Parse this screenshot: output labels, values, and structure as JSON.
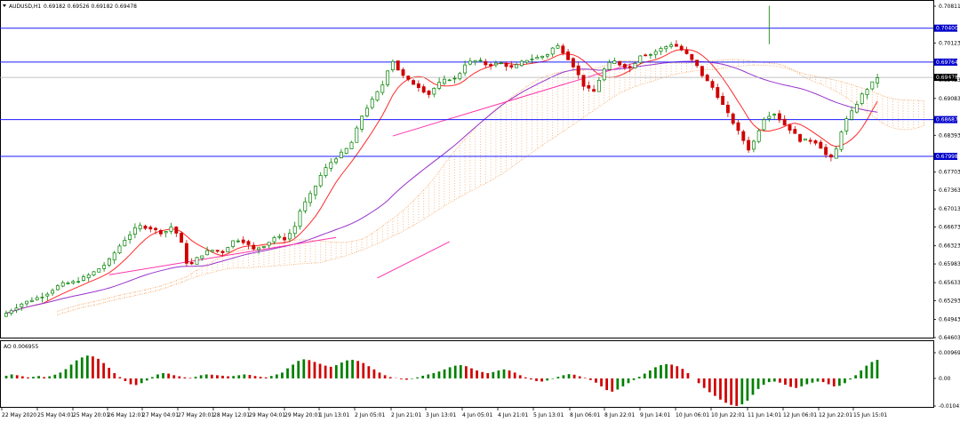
{
  "chart_data": {
    "type": "candlestick",
    "symbol_header": "AUDUSD,H1",
    "ohlc_header": "0.69182 0.69526 0.69182 0.69478",
    "price_axis_ticks": [
      "0.70811",
      "0.70123",
      "0.69433",
      "0.69083",
      "0.68393",
      "0.67703",
      "0.67363",
      "0.67013",
      "0.66673",
      "0.66323",
      "0.65983",
      "0.65633",
      "0.65293",
      "0.64943",
      "0.64603"
    ],
    "ylim": [
      0.64603,
      0.70811
    ],
    "horizontal_levels": [
      {
        "label": "0.70400",
        "value": 0.704
      },
      {
        "label": "0.69764",
        "value": 0.69764
      },
      {
        "label": "0.68687",
        "value": 0.68687
      },
      {
        "label": "0.67998",
        "value": 0.67998
      }
    ],
    "current_price": {
      "label": "0.69478",
      "value": 0.69478
    },
    "time_labels": [
      "22 May 2020",
      "25 May 04:01",
      "25 May 20:01",
      "26 May 12:01",
      "27 May 04:01",
      "27 May 20:01",
      "28 May 12:01",
      "29 May 04:01",
      "29 May 20:01",
      "1 Jun 13:01",
      "2 Jun 05:01",
      "2 Jun 21:01",
      "3 Jun 13:01",
      "4 Jun 05:01",
      "4 Jun 21:01",
      "5 Jun 13:01",
      "8 Jun 06:01",
      "8 Jun 22:01",
      "9 Jun 14:01",
      "10 Jun 06:01",
      "10 Jun 22:01",
      "11 Jun 14:01",
      "12 Jun 06:01",
      "12 Jun 22:01",
      "15 Jun 15:01"
    ],
    "ao_indicator": {
      "header": "AO 0.006955",
      "ticks": [
        "0.009697",
        "0.00",
        "-0.010417"
      ],
      "ylim": [
        -0.010417,
        0.009697
      ]
    },
    "close_path": [
      [
        0,
        0.65
      ],
      [
        14,
        0.6525
      ],
      [
        28,
        0.654
      ],
      [
        38,
        0.656
      ],
      [
        48,
        0.6565
      ],
      [
        58,
        0.658
      ],
      [
        68,
        0.66
      ],
      [
        78,
        0.664
      ],
      [
        88,
        0.667
      ],
      [
        96,
        0.6665
      ],
      [
        104,
        0.6655
      ],
      [
        110,
        0.667
      ],
      [
        116,
        0.6635
      ],
      [
        120,
        0.659
      ],
      [
        126,
        0.661
      ],
      [
        134,
        0.6625
      ],
      [
        142,
        0.662
      ],
      [
        150,
        0.6645
      ],
      [
        156,
        0.664
      ],
      [
        162,
        0.6625
      ],
      [
        170,
        0.6635
      ],
      [
        176,
        0.665
      ],
      [
        182,
        0.6645
      ],
      [
        188,
        0.6665
      ],
      [
        192,
        0.67
      ],
      [
        200,
        0.6735
      ],
      [
        206,
        0.677
      ],
      [
        212,
        0.679
      ],
      [
        218,
        0.6805
      ],
      [
        224,
        0.682
      ],
      [
        232,
        0.688
      ],
      [
        238,
        0.6905
      ],
      [
        246,
        0.694
      ],
      [
        250,
        0.6985
      ],
      [
        256,
        0.6955
      ],
      [
        262,
        0.694
      ],
      [
        268,
        0.693
      ],
      [
        274,
        0.6915
      ],
      [
        280,
        0.6935
      ],
      [
        286,
        0.6945
      ],
      [
        292,
        0.6945
      ],
      [
        298,
        0.6975
      ],
      [
        306,
        0.698
      ],
      [
        312,
        0.697
      ],
      [
        320,
        0.6975
      ],
      [
        328,
        0.6965
      ],
      [
        336,
        0.698
      ],
      [
        344,
        0.6985
      ],
      [
        350,
        0.699
      ],
      [
        356,
        0.701
      ],
      [
        362,
        0.699
      ],
      [
        368,
        0.6965
      ],
      [
        374,
        0.693
      ],
      [
        380,
        0.692
      ],
      [
        386,
        0.696
      ],
      [
        392,
        0.698
      ],
      [
        398,
        0.697
      ],
      [
        404,
        0.6965
      ],
      [
        410,
        0.699
      ],
      [
        416,
        0.699
      ],
      [
        422,
        0.7
      ],
      [
        430,
        0.701
      ],
      [
        434,
        0.7005
      ],
      [
        440,
        0.699
      ],
      [
        446,
        0.697
      ],
      [
        450,
        0.695
      ],
      [
        456,
        0.693
      ],
      [
        462,
        0.69
      ],
      [
        468,
        0.687
      ],
      [
        474,
        0.684
      ],
      [
        480,
        0.681
      ],
      [
        486,
        0.685
      ],
      [
        490,
        0.6875
      ],
      [
        496,
        0.688
      ],
      [
        502,
        0.686
      ],
      [
        508,
        0.6845
      ],
      [
        512,
        0.683
      ],
      [
        518,
        0.683
      ],
      [
        524,
        0.6825
      ],
      [
        528,
        0.6805
      ],
      [
        532,
        0.6795
      ],
      [
        536,
        0.6815
      ],
      [
        540,
        0.686
      ],
      [
        546,
        0.6885
      ],
      [
        552,
        0.6915
      ],
      [
        558,
        0.6935
      ],
      [
        562,
        0.6948
      ]
    ],
    "ao_values": [
      0.001,
      0.0015,
      0.0012,
      0.0008,
      0.0004,
      0.0006,
      0.0009,
      0.0005,
      0.0008,
      0.0014,
      0.0022,
      0.0035,
      0.0052,
      0.0068,
      0.0079,
      0.0086,
      0.0083,
      0.0074,
      0.0058,
      0.004,
      0.002,
      0.0005,
      -0.001,
      -0.0022,
      -0.0025,
      -0.0018,
      -0.0008,
      0.0005,
      0.0015,
      0.002,
      0.0018,
      0.0012,
      0.0008,
      0.0004,
      0.0002,
      0.0006,
      0.0012,
      0.0015,
      0.0014,
      0.0012,
      0.001,
      0.0008,
      0.0009,
      0.0012,
      0.0015,
      0.0013,
      0.0009,
      0.0006,
      0.0004,
      0.0009,
      0.0015,
      0.0022,
      0.0038,
      0.0052,
      0.0066,
      0.0072,
      0.0069,
      0.0062,
      0.0055,
      0.0048,
      0.0044,
      0.005,
      0.006,
      0.0068,
      0.007,
      0.0066,
      0.0058,
      0.0046,
      0.0034,
      0.0022,
      0.0012,
      0.0005,
      0.0001,
      -0.0003,
      -0.0005,
      -0.0002,
      0.0004,
      0.001,
      0.0015,
      0.002,
      0.0026,
      0.0034,
      0.0042,
      0.0048,
      0.005,
      0.0046,
      0.0038,
      0.003,
      0.0024,
      0.002,
      0.0024,
      0.003,
      0.0034,
      0.003,
      0.0022,
      0.0012,
      0.0004,
      -0.0004,
      -0.001,
      -0.0012,
      -0.0008,
      -0.0002,
      0.0006,
      0.0012,
      0.0016,
      0.0014,
      0.0008,
      0.0002,
      -0.0006,
      -0.0016,
      -0.003,
      -0.0044,
      -0.005,
      -0.0042,
      -0.003,
      -0.0018,
      -0.0006,
      0.0006,
      0.0018,
      0.003,
      0.0042,
      0.005,
      0.0054,
      0.0052,
      0.0046,
      0.0036,
      0.002,
      0.0,
      -0.0018,
      -0.0036,
      -0.0052,
      -0.0066,
      -0.008,
      -0.0092,
      -0.01,
      -0.0104,
      -0.0098,
      -0.0084,
      -0.0062,
      -0.004,
      -0.0024,
      -0.0014,
      -0.0012,
      -0.0016,
      -0.0024,
      -0.0032,
      -0.0036,
      -0.003,
      -0.0022,
      -0.0016,
      -0.0012,
      -0.0014,
      -0.0022,
      -0.003,
      -0.0028,
      -0.0018,
      -0.0004,
      0.0012,
      0.003,
      0.0048,
      0.0062,
      0.007
    ]
  },
  "colors": {
    "candle_up": "#008000",
    "candle_down": "#d00000",
    "level_line": "#1a1aff",
    "level_tag": "#0000cc",
    "ma_fast": "#ff2a2a",
    "ma_slow": "#9933cc",
    "trendline": "#ff33aa",
    "cloud": "#f4a460",
    "axis": "#000000",
    "price_tag_bg": "#000000"
  }
}
